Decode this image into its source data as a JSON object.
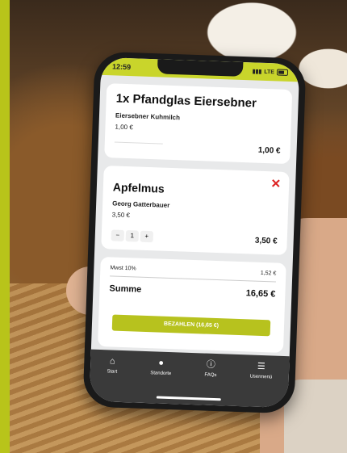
{
  "status": {
    "time": "12:59",
    "network": "LTE"
  },
  "items": [
    {
      "title": "1x Pfandglas Eiersebner",
      "producer": "Eiersebner Kuhmilch",
      "unit_price": "1,00 €",
      "total": "1,00 €"
    },
    {
      "title": "Apfelmus",
      "producer": "Georg Gatterbauer",
      "unit_price": "3,50 €",
      "quantity": "1",
      "minus": "−",
      "plus": "+",
      "total": "3,50 €",
      "delete": "✕"
    }
  ],
  "summary": {
    "mwst_label": "Mwst 10%",
    "mwst_value": "1,52 €",
    "summe_label": "Summe",
    "summe_value": "16,65 €"
  },
  "pay_button": "BEZAHLEN (16,65 €)",
  "nav": [
    {
      "label": "Start",
      "icon": "home-icon",
      "glyph": "⌂"
    },
    {
      "label": "Standorte",
      "icon": "location-pin-icon",
      "glyph": "●"
    },
    {
      "label": "FAQs",
      "icon": "info-icon",
      "glyph": "ⓘ"
    },
    {
      "label": "Usermenü",
      "icon": "menu-icon",
      "glyph": "☰"
    }
  ],
  "colors": {
    "accent": "#c9d52b",
    "button": "#b7c21e",
    "delete": "#dd2222",
    "nav_bg": "#3a3a3a"
  }
}
